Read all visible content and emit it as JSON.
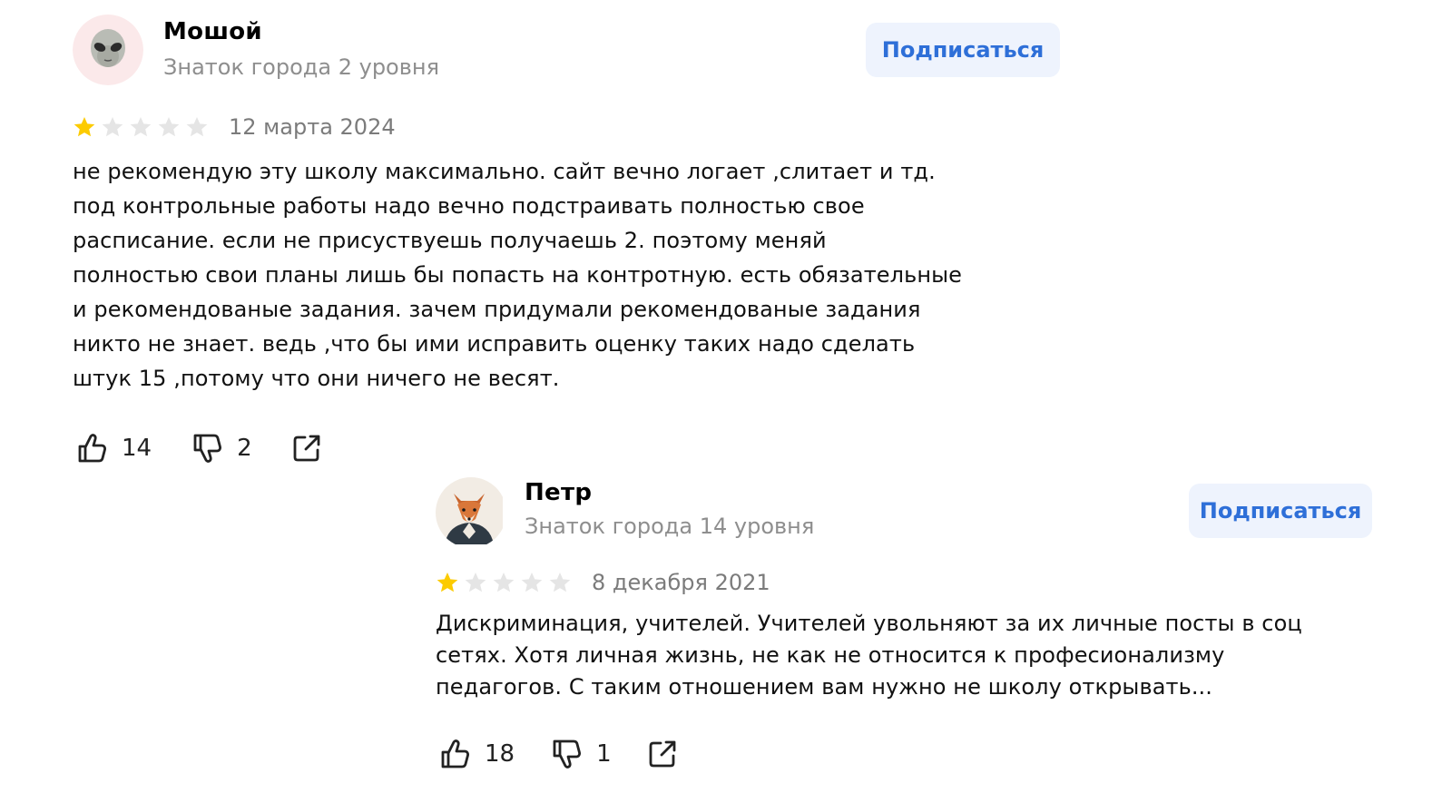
{
  "reviews": [
    {
      "author": "Мошой",
      "level": "Знаток города 2 уровня",
      "subscribe_label": "Подписаться",
      "avatar_icon": "alien-emoji-avatar",
      "rating": 1,
      "rating_max": 5,
      "date": "12 марта 2024",
      "text": "не рекомендую эту школу максимально. сайт вечно логает ,слитает и тд.\nпод контрольные работы надо вечно подстраивать полностью свое\nрасписание. если не присуствуешь получаешь 2. поэтому меняй\nполностью свои планы лишь бы попасть на контротную. есть обязательные\nи рекомендованые задания. зачем придумали рекомендованые задания\nникто не знает. ведь ,что бы ими исправить оценку таких надо сделать\nштук 15 ,потому что они ничего не весят.",
      "likes": "14",
      "dislikes": "2"
    },
    {
      "author": "Петр",
      "level": "Знаток города 14 уровня",
      "subscribe_label": "Подписаться",
      "avatar_icon": "fox-photo-avatar",
      "rating": 1,
      "rating_max": 5,
      "date": "8 декабря 2021",
      "text": "Дискриминация, учителей. Учителей увольняют за их личные посты в соц\nсетях. Хотя личная жизнь, не как не относится к професионализму\nпедагогов. С таким отношением вам нужно не школу открывать...",
      "likes": "18",
      "dislikes": "1"
    }
  ],
  "colors": {
    "star_filled": "#fccb00",
    "star_empty": "#e5e5e5",
    "subscribe_bg": "#eef3fd",
    "subscribe_text": "#2e6fd8",
    "muted_text": "#8e8e8e"
  },
  "icons": [
    "thumbs-up-icon",
    "thumbs-down-icon",
    "share-icon",
    "star-icon"
  ]
}
